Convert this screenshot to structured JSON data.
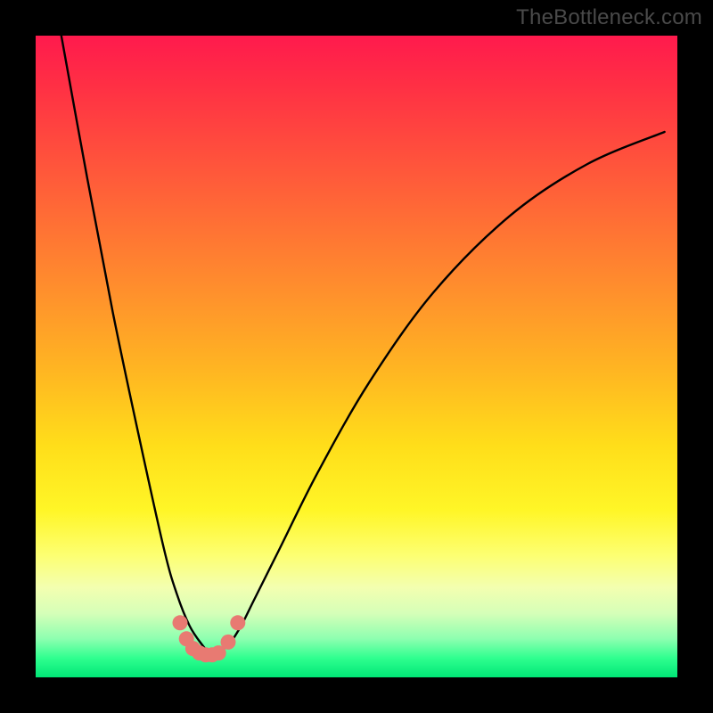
{
  "watermark": "TheBottleneck.com",
  "chart_data": {
    "type": "line",
    "title": "",
    "xlabel": "",
    "ylabel": "",
    "xlim": [
      0,
      100
    ],
    "ylim": [
      0,
      100
    ],
    "grid": false,
    "series": [
      {
        "name": "bottleneck-curve",
        "x": [
          4,
          8,
          12,
          16,
          20,
          22,
          24,
          26,
          27,
          28,
          30,
          32,
          34,
          38,
          44,
          52,
          62,
          74,
          86,
          98
        ],
        "y": [
          100,
          78,
          57,
          38,
          20,
          13,
          8,
          5,
          4,
          4,
          5,
          8,
          12,
          20,
          32,
          46,
          60,
          72,
          80,
          85
        ]
      }
    ],
    "markers": {
      "name": "valley-points",
      "color": "#e87a72",
      "x": [
        22.5,
        23.5,
        24.5,
        25.5,
        26.5,
        27.5,
        28.5,
        30.0,
        31.5
      ],
      "y": [
        8.5,
        6.0,
        4.5,
        3.8,
        3.5,
        3.5,
        3.8,
        5.5,
        8.5
      ]
    },
    "background_gradient": {
      "top": "#ff1a4d",
      "mid": "#ffde1a",
      "bottom": "#00e676"
    }
  }
}
